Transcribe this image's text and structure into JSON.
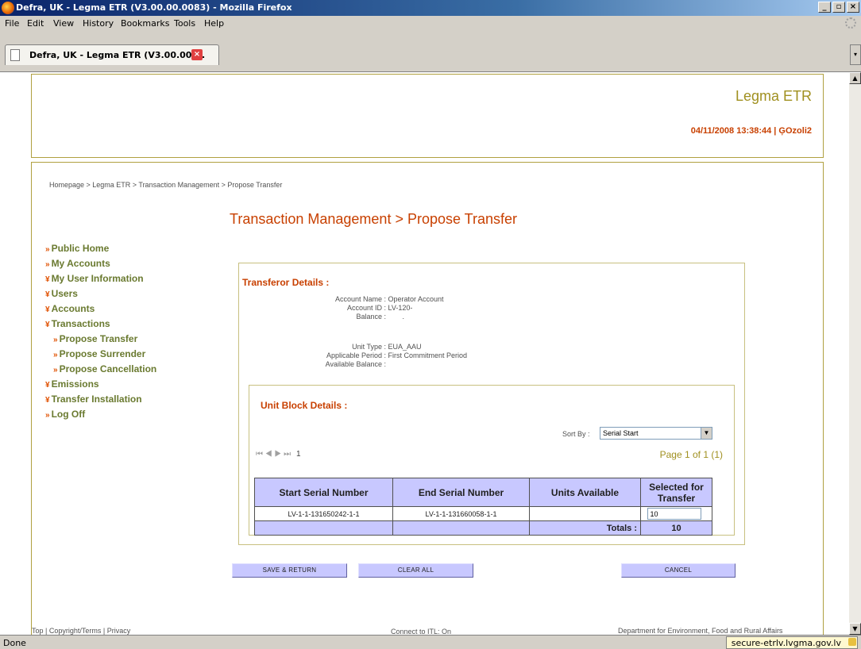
{
  "window": {
    "title": "Defra, UK - Legma ETR (V3.00.00.0083) - Mozilla Firefox",
    "min": "_",
    "max": "▫",
    "close": "×"
  },
  "menu": [
    "File",
    "Edit",
    "View",
    "History",
    "Bookmarks",
    "Tools",
    "Help"
  ],
  "tab": {
    "label": "Defra, UK - Legma ETR (V3.00.00....",
    "close": "×"
  },
  "header": {
    "app_title": "Legma ETR",
    "datetime_user": "04/11/2008 13:38:44 | ĢOzoli2"
  },
  "breadcrumb": "Homepage > Legma ETR > Transaction Management > Propose Transfer",
  "page_title": "Transaction Management > Propose Transfer",
  "nav": [
    {
      "label": "Public Home",
      "bullet": "»",
      "sub": false
    },
    {
      "label": "My Accounts",
      "bullet": "»",
      "sub": false
    },
    {
      "label": "My User Information",
      "bullet": "¥",
      "sub": false
    },
    {
      "label": "Users",
      "bullet": "¥",
      "sub": false
    },
    {
      "label": "Accounts",
      "bullet": "¥",
      "sub": false
    },
    {
      "label": "Transactions",
      "bullet": "¥",
      "sub": false
    },
    {
      "label": "Propose Transfer",
      "bullet": "»",
      "sub": true
    },
    {
      "label": "Propose Surrender",
      "bullet": "»",
      "sub": true
    },
    {
      "label": "Propose Cancellation",
      "bullet": "»",
      "sub": true
    },
    {
      "label": "Emissions",
      "bullet": "¥",
      "sub": false
    },
    {
      "label": "Transfer Installation",
      "bullet": "¥",
      "sub": false
    },
    {
      "label": "Log Off",
      "bullet": "»",
      "sub": false
    }
  ],
  "transferor": {
    "heading": "Transferor Details :",
    "rows": [
      {
        "k": "Account Name :",
        "v": "Operator Account"
      },
      {
        "k": "Account ID :",
        "v": "LV-120-"
      },
      {
        "k": "Balance :",
        "v": "."
      },
      {
        "k": "Unit Type :",
        "v": "EUA_AAU"
      },
      {
        "k": "Applicable Period :",
        "v": "First Commitment Period"
      },
      {
        "k": "Available Balance :",
        "v": ""
      }
    ]
  },
  "unit_block": {
    "heading": "Unit Block Details :",
    "sort_label": "Sort By :",
    "sort_value": "Serial Start",
    "pager_arrows": "⏮ ◀ ▶ ⏭",
    "pager_page": "1",
    "page_info": "Page 1 of 1  (1)",
    "columns": [
      "Start Serial Number",
      "End Serial Number",
      "Units Available",
      "Selected for Transfer"
    ],
    "rows": [
      {
        "start": "LV-1-1-131650242-1-1",
        "end": "LV-1-1-131660058-1-1",
        "units": "",
        "selected": "10"
      }
    ],
    "totals_label": "Totals :",
    "totals_value": "10"
  },
  "buttons": {
    "save_return": "SAVE & RETURN",
    "clear_all": "CLEAR ALL",
    "cancel": "CANCEL"
  },
  "footer": {
    "links": "Top | Copyright/Terms | Privacy",
    "itl": "Connect to ITL: On",
    "dept": "Department for Environment, Food and Rural Affairs"
  },
  "status": {
    "text": "Done",
    "domain": "secure-etrlv.lvgma.gov.lv"
  }
}
